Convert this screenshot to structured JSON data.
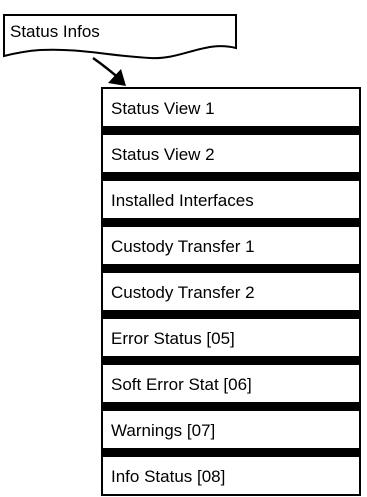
{
  "header": {
    "label": "Status Infos"
  },
  "menu": {
    "items": [
      {
        "label": "Status View 1"
      },
      {
        "label": "Status View 2"
      },
      {
        "label": "Installed Interfaces"
      },
      {
        "label": "Custody Transfer 1"
      },
      {
        "label": "Custody Transfer 2"
      },
      {
        "label": "Error Status [05]"
      },
      {
        "label": "Soft Error Stat [06]"
      },
      {
        "label": "Warnings [07]"
      },
      {
        "label": "Info Status [08]"
      }
    ]
  },
  "colors": {
    "stroke": "#000000",
    "fill": "#ffffff"
  }
}
